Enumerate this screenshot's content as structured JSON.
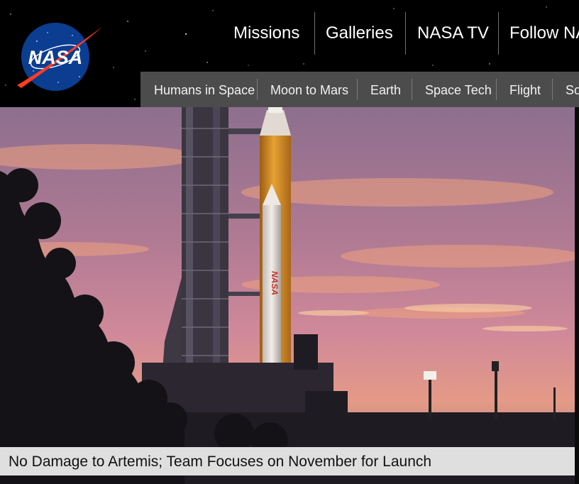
{
  "header": {
    "logo_text": "NASA",
    "primary_nav": [
      "Missions",
      "Galleries",
      "NASA TV",
      "Follow NASA"
    ],
    "secondary_nav": [
      "Humans in Space",
      "Moon to Mars",
      "Earth",
      "Space Tech",
      "Flight",
      "Solar System"
    ]
  },
  "hero": {
    "image_subject": "Artemis rocket on launch pad at sunset",
    "rocket_text": "NASA",
    "caption": "No Damage to Artemis; Team Focuses on November for Launch"
  },
  "colors": {
    "header_bg": "#000000",
    "secondary_nav_bg": "#4c4c4c",
    "logo_blue": "#0b3d91",
    "logo_red": "#fc3d21",
    "rocket_orange": "#e39a2a",
    "sky_pink": "#c97f98",
    "caption_bg": "#ececec"
  }
}
